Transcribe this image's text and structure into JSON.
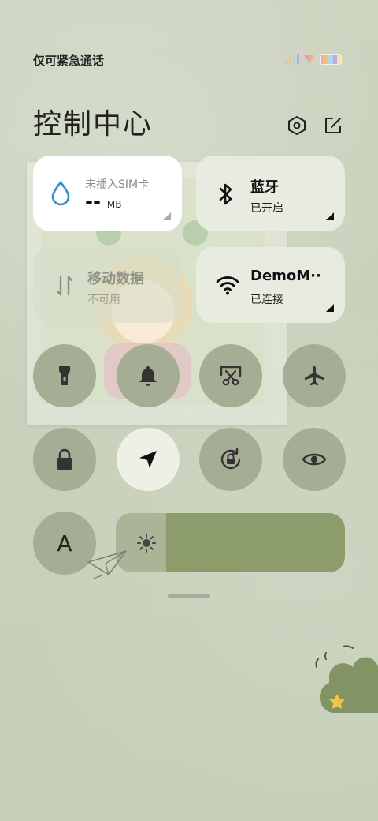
{
  "status_bar": {
    "carrier_text": "仅可紧急通话"
  },
  "header": {
    "title": "控制中心",
    "settings_icon": "hexagon-settings-icon",
    "edit_icon": "edit-icon"
  },
  "tiles": {
    "data_usage": {
      "title": "未插入SIM卡",
      "value": "--",
      "unit": "MB"
    },
    "mobile_data": {
      "title": "移动数据",
      "status": "不可用"
    },
    "bluetooth": {
      "title": "蓝牙",
      "status": "已开启"
    },
    "wifi": {
      "title": "DemoM··",
      "status": "已连接"
    }
  },
  "quick_toggles": [
    {
      "name": "flashlight",
      "icon": "flashlight-icon",
      "active": false
    },
    {
      "name": "ringer",
      "icon": "bell-icon",
      "active": false
    },
    {
      "name": "screenshot",
      "icon": "scissors-icon",
      "active": false
    },
    {
      "name": "airplane-mode",
      "icon": "airplane-icon",
      "active": false
    },
    {
      "name": "lock-screen",
      "icon": "lock-icon",
      "active": false
    },
    {
      "name": "location",
      "icon": "location-arrow-icon",
      "active": true
    },
    {
      "name": "auto-rotate",
      "icon": "rotate-lock-icon",
      "active": false
    },
    {
      "name": "eye-comfort",
      "icon": "eye-icon",
      "active": false
    }
  ],
  "font_toggle": {
    "label": "A"
  },
  "brightness": {
    "level": 0.22,
    "icon": "sun-icon"
  },
  "colors": {
    "background": "#c9d2bd",
    "toggle_inactive": "#a5ad95",
    "toggle_active": "#eef0e6",
    "slider_track": "#8d9c6b",
    "slider_fill": "#aab497",
    "data_drop": "#2b8fe0"
  }
}
